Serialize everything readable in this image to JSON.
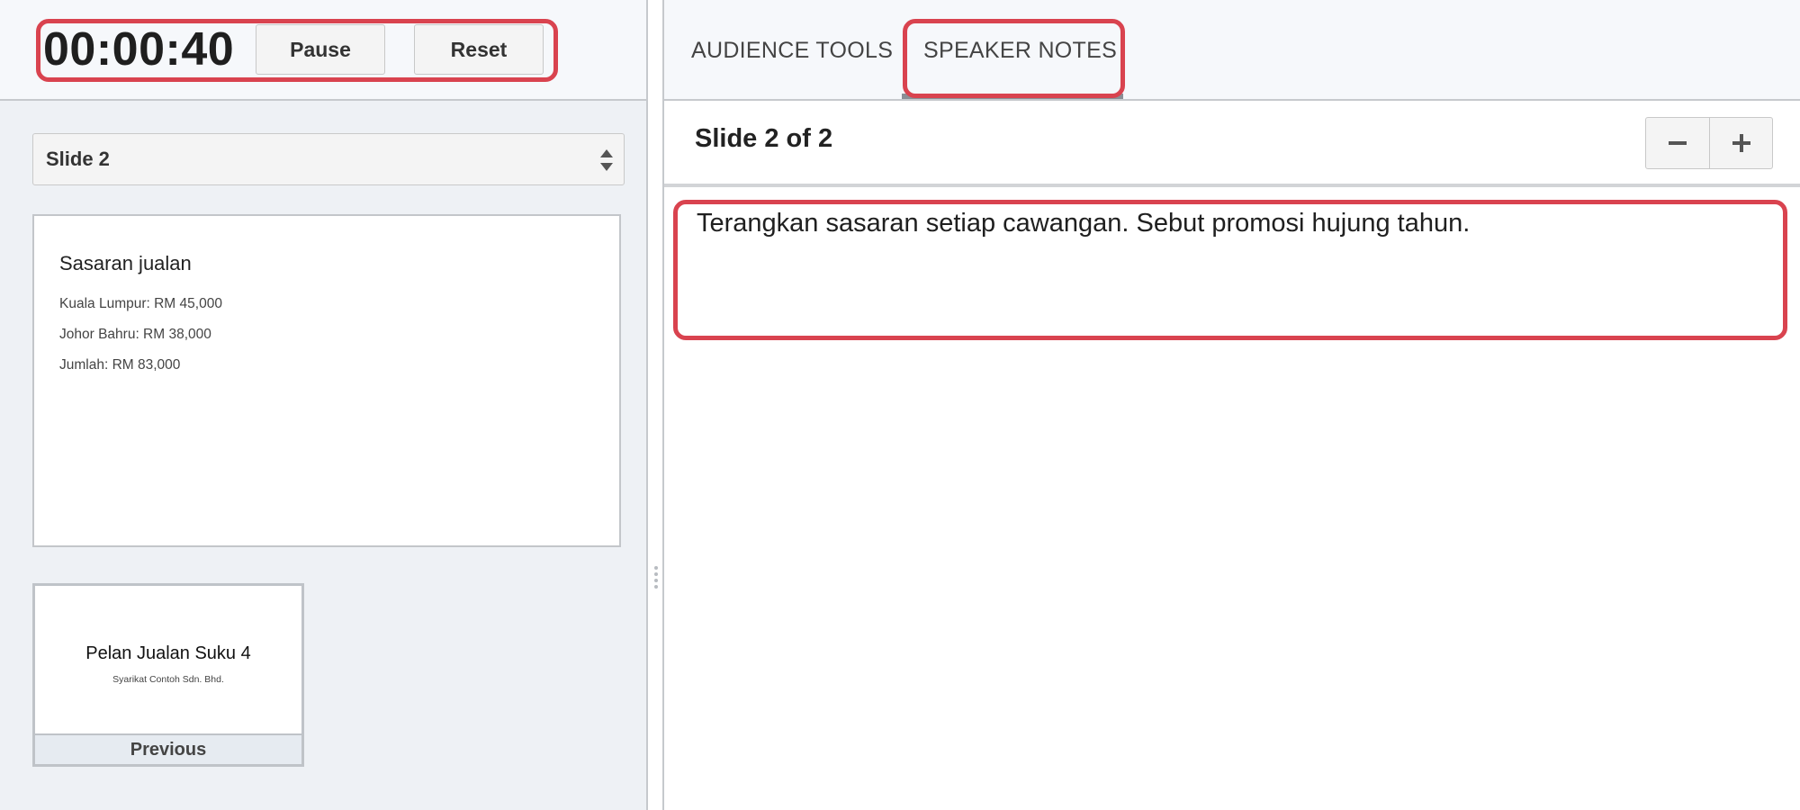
{
  "timer": {
    "elapsed": "00:00:40",
    "pause_label": "Pause",
    "reset_label": "Reset"
  },
  "slide_selector": {
    "selected": "Slide 2"
  },
  "current_slide": {
    "title": "Sasaran jualan",
    "bullets": [
      "Kuala Lumpur: RM 45,000",
      "Johor Bahru: RM 38,000",
      "Jumlah: RM 83,000"
    ]
  },
  "previous_slide": {
    "title": "Pelan Jualan Suku 4",
    "subtitle": "Syarikat Contoh Sdn. Bhd.",
    "label": "Previous"
  },
  "tabs": [
    {
      "label": "AUDIENCE TOOLS",
      "active": false
    },
    {
      "label": "SPEAKER NOTES",
      "active": true
    }
  ],
  "notes": {
    "slide_count": "Slide 2 of 2",
    "text": "Terangkan sasaran setiap cawangan. Sebut promosi hujung tahun."
  },
  "icons": {
    "zoom_out": "minus-icon",
    "zoom_in": "plus-icon",
    "select": "up-down-arrows-icon",
    "resize": "drag-handle-icon"
  },
  "colors": {
    "highlight": "#d9434f",
    "header_bg": "#f6f8fb",
    "pane_bg": "#eef1f5"
  }
}
